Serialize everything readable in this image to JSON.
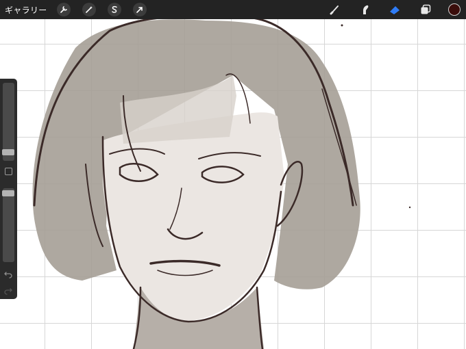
{
  "toolbar": {
    "gallery_label": "ギャラリー",
    "left_tools": [
      {
        "name": "actions",
        "icon": "wrench-icon"
      },
      {
        "name": "adjustments",
        "icon": "magic-wand-icon"
      },
      {
        "name": "selection",
        "icon": "selection-s-icon"
      },
      {
        "name": "transform",
        "icon": "arrow-cursor-icon"
      }
    ],
    "right_tools": [
      {
        "name": "brush",
        "icon": "brush-icon",
        "active": false
      },
      {
        "name": "smudge",
        "icon": "smudge-icon",
        "active": false
      },
      {
        "name": "eraser",
        "icon": "eraser-icon",
        "active": true
      },
      {
        "name": "layers",
        "icon": "layers-icon",
        "active": false
      },
      {
        "name": "color",
        "icon": "color-swatch",
        "value": "#3a0d0b"
      }
    ]
  },
  "sidebar": {
    "brush_size_level": 0.62,
    "opacity_level": 0.05,
    "modify_button_icon": "square-icon",
    "undo_icon": "undo-icon",
    "redo_icon": "redo-icon"
  },
  "colors": {
    "toolbar_bg": "#232323",
    "accent_active": "#2f7cf6",
    "grid_line": "#d6d6d6",
    "sketch_line": "#3b2a28",
    "fill_gray": "#a9a29a"
  }
}
